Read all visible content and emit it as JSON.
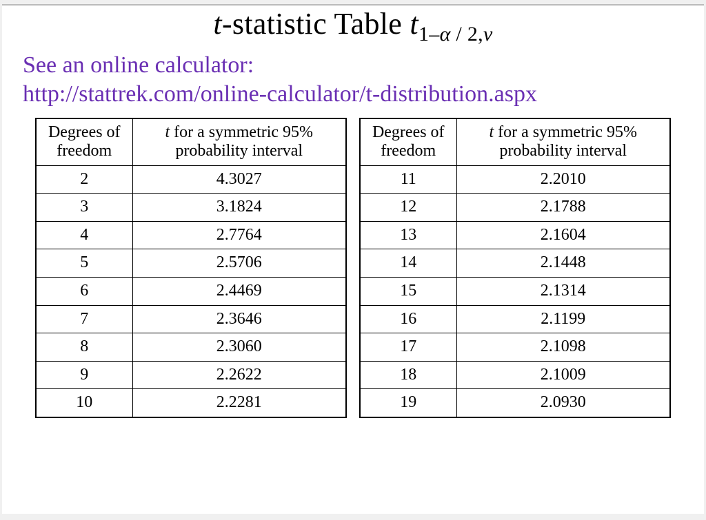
{
  "title": {
    "prefix_italic": "t",
    "main": "-statistic Table  ",
    "symbol_italic": "t",
    "sub_plain_1": "1–",
    "sub_italic_1": "α",
    "sub_plain_2": " / 2,",
    "sub_italic_2": "v"
  },
  "intro": {
    "see_line": "See an online calculator:",
    "url_text": "http://stattrek.com/online-calculator/t-distribution.aspx"
  },
  "table_headers": {
    "df": "Degrees of\nfreedom",
    "val_prefix_italic": "t",
    "val_rest": " for a symmetric 95%\nprobability interval"
  },
  "left_rows": [
    {
      "df": "2",
      "val": "4.3027"
    },
    {
      "df": "3",
      "val": "3.1824"
    },
    {
      "df": "4",
      "val": "2.7764"
    },
    {
      "df": "5",
      "val": "2.5706"
    },
    {
      "df": "6",
      "val": "2.4469"
    },
    {
      "df": "7",
      "val": "2.3646"
    },
    {
      "df": "8",
      "val": "2.3060"
    },
    {
      "df": "9",
      "val": "2.2622"
    },
    {
      "df": "10",
      "val": "2.2281"
    }
  ],
  "right_rows": [
    {
      "df": "11",
      "val": "2.2010"
    },
    {
      "df": "12",
      "val": "2.1788"
    },
    {
      "df": "13",
      "val": "2.1604"
    },
    {
      "df": "14",
      "val": "2.1448"
    },
    {
      "df": "15",
      "val": "2.1314"
    },
    {
      "df": "16",
      "val": "2.1199"
    },
    {
      "df": "17",
      "val": "2.1098"
    },
    {
      "df": "18",
      "val": "2.1009"
    },
    {
      "df": "19",
      "val": "2.0930"
    }
  ],
  "chart_data": {
    "type": "table",
    "title": "t-statistic Table t_{1-α/2, v}",
    "columns": [
      "Degrees of freedom",
      "t for a symmetric 95% probability interval"
    ],
    "rows": [
      [
        2,
        4.3027
      ],
      [
        3,
        3.1824
      ],
      [
        4,
        2.7764
      ],
      [
        5,
        2.5706
      ],
      [
        6,
        2.4469
      ],
      [
        7,
        2.3646
      ],
      [
        8,
        2.306
      ],
      [
        9,
        2.2622
      ],
      [
        10,
        2.2281
      ],
      [
        11,
        2.201
      ],
      [
        12,
        2.1788
      ],
      [
        13,
        2.1604
      ],
      [
        14,
        2.1448
      ],
      [
        15,
        2.1314
      ],
      [
        16,
        2.1199
      ],
      [
        17,
        2.1098
      ],
      [
        18,
        2.1009
      ],
      [
        19,
        2.093
      ]
    ]
  }
}
